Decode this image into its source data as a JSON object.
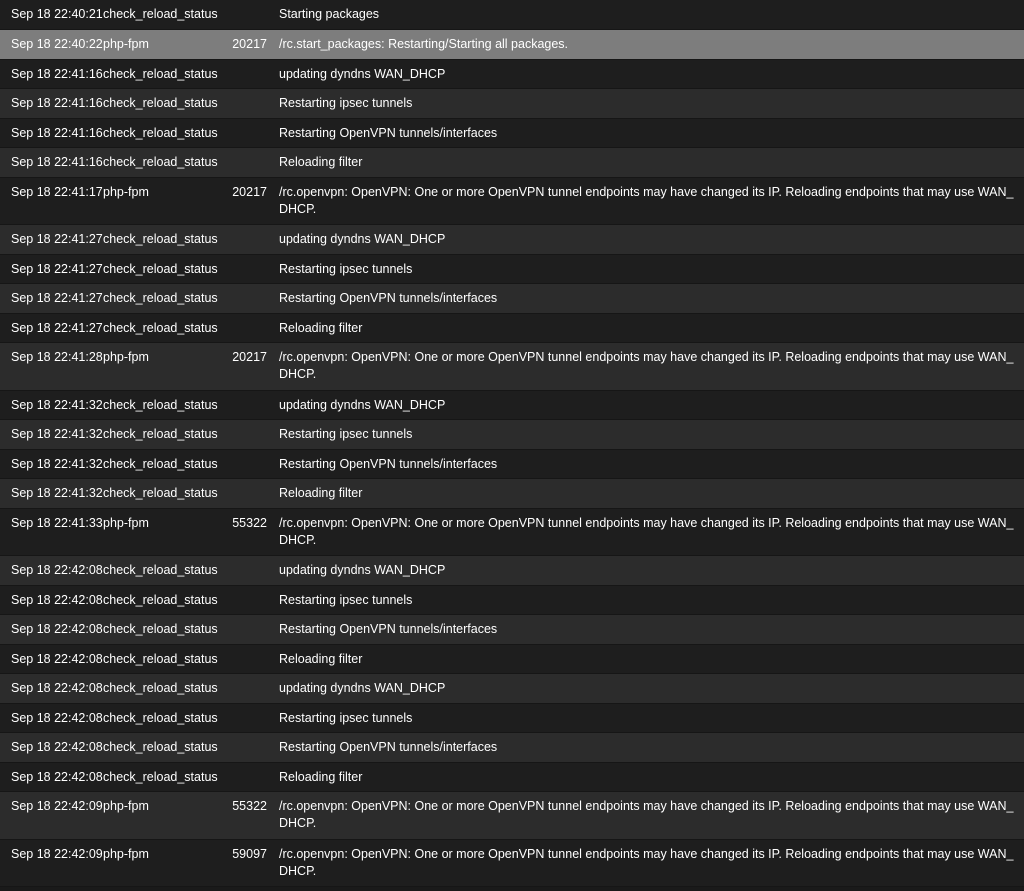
{
  "selected_row": 1,
  "rows": [
    {
      "time": "Sep 18 22:40:21",
      "process": "check_reload_status",
      "pid": "",
      "message": "Starting packages"
    },
    {
      "time": "Sep 18 22:40:22",
      "process": "php-fpm",
      "pid": "20217",
      "message": "/rc.start_packages: Restarting/Starting all packages."
    },
    {
      "time": "Sep 18 22:41:16",
      "process": "check_reload_status",
      "pid": "",
      "message": "updating dyndns WAN_DHCP"
    },
    {
      "time": "Sep 18 22:41:16",
      "process": "check_reload_status",
      "pid": "",
      "message": "Restarting ipsec tunnels"
    },
    {
      "time": "Sep 18 22:41:16",
      "process": "check_reload_status",
      "pid": "",
      "message": "Restarting OpenVPN tunnels/interfaces"
    },
    {
      "time": "Sep 18 22:41:16",
      "process": "check_reload_status",
      "pid": "",
      "message": "Reloading filter"
    },
    {
      "time": "Sep 18 22:41:17",
      "process": "php-fpm",
      "pid": "20217",
      "message": "/rc.openvpn: OpenVPN: One or more OpenVPN tunnel endpoints may have changed its IP. Reloading endpoints that may use WAN_DHCP."
    },
    {
      "time": "Sep 18 22:41:27",
      "process": "check_reload_status",
      "pid": "",
      "message": "updating dyndns WAN_DHCP"
    },
    {
      "time": "Sep 18 22:41:27",
      "process": "check_reload_status",
      "pid": "",
      "message": "Restarting ipsec tunnels"
    },
    {
      "time": "Sep 18 22:41:27",
      "process": "check_reload_status",
      "pid": "",
      "message": "Restarting OpenVPN tunnels/interfaces"
    },
    {
      "time": "Sep 18 22:41:27",
      "process": "check_reload_status",
      "pid": "",
      "message": "Reloading filter"
    },
    {
      "time": "Sep 18 22:41:28",
      "process": "php-fpm",
      "pid": "20217",
      "message": "/rc.openvpn: OpenVPN: One or more OpenVPN tunnel endpoints may have changed its IP. Reloading endpoints that may use WAN_DHCP."
    },
    {
      "time": "Sep 18 22:41:32",
      "process": "check_reload_status",
      "pid": "",
      "message": "updating dyndns WAN_DHCP"
    },
    {
      "time": "Sep 18 22:41:32",
      "process": "check_reload_status",
      "pid": "",
      "message": "Restarting ipsec tunnels"
    },
    {
      "time": "Sep 18 22:41:32",
      "process": "check_reload_status",
      "pid": "",
      "message": "Restarting OpenVPN tunnels/interfaces"
    },
    {
      "time": "Sep 18 22:41:32",
      "process": "check_reload_status",
      "pid": "",
      "message": "Reloading filter"
    },
    {
      "time": "Sep 18 22:41:33",
      "process": "php-fpm",
      "pid": "55322",
      "message": "/rc.openvpn: OpenVPN: One or more OpenVPN tunnel endpoints may have changed its IP. Reloading endpoints that may use WAN_DHCP."
    },
    {
      "time": "Sep 18 22:42:08",
      "process": "check_reload_status",
      "pid": "",
      "message": "updating dyndns WAN_DHCP"
    },
    {
      "time": "Sep 18 22:42:08",
      "process": "check_reload_status",
      "pid": "",
      "message": "Restarting ipsec tunnels"
    },
    {
      "time": "Sep 18 22:42:08",
      "process": "check_reload_status",
      "pid": "",
      "message": "Restarting OpenVPN tunnels/interfaces"
    },
    {
      "time": "Sep 18 22:42:08",
      "process": "check_reload_status",
      "pid": "",
      "message": "Reloading filter"
    },
    {
      "time": "Sep 18 22:42:08",
      "process": "check_reload_status",
      "pid": "",
      "message": "updating dyndns WAN_DHCP"
    },
    {
      "time": "Sep 18 22:42:08",
      "process": "check_reload_status",
      "pid": "",
      "message": "Restarting ipsec tunnels"
    },
    {
      "time": "Sep 18 22:42:08",
      "process": "check_reload_status",
      "pid": "",
      "message": "Restarting OpenVPN tunnels/interfaces"
    },
    {
      "time": "Sep 18 22:42:08",
      "process": "check_reload_status",
      "pid": "",
      "message": "Reloading filter"
    },
    {
      "time": "Sep 18 22:42:09",
      "process": "php-fpm",
      "pid": "55322",
      "message": "/rc.openvpn: OpenVPN: One or more OpenVPN tunnel endpoints may have changed its IP. Reloading endpoints that may use WAN_DHCP."
    },
    {
      "time": "Sep 18 22:42:09",
      "process": "php-fpm",
      "pid": "59097",
      "message": "/rc.openvpn: OpenVPN: One or more OpenVPN tunnel endpoints may have changed its IP. Reloading endpoints that may use WAN_DHCP."
    }
  ]
}
